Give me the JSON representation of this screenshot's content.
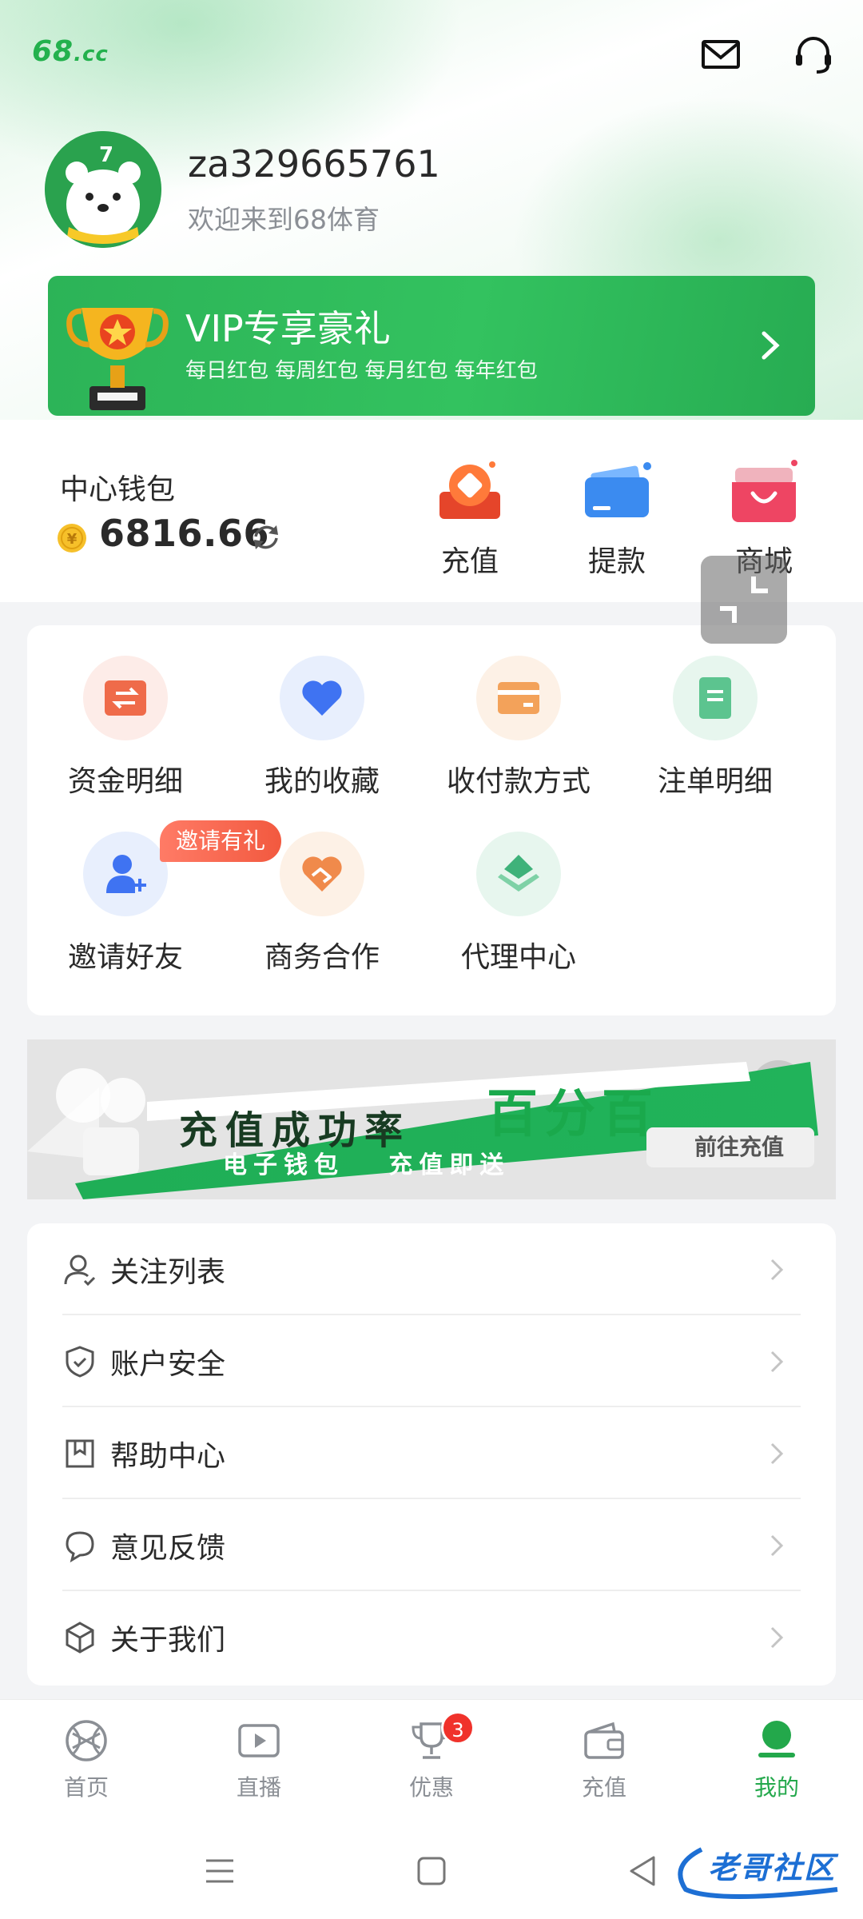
{
  "header": {
    "logo": "68",
    "logo_suffix": ".cc",
    "username": "za329665761",
    "welcome": "欢迎来到68体育"
  },
  "vip": {
    "title": "VIP专享豪礼",
    "subtitle": "每日红包 每周红包 每月红包 每年红包"
  },
  "wallet": {
    "label": "中心钱包",
    "balance": "6816.66",
    "actions": [
      {
        "label": "充值",
        "icon": "recharge-icon"
      },
      {
        "label": "提款",
        "icon": "withdraw-icon"
      },
      {
        "label": "商城",
        "icon": "mall-icon"
      }
    ]
  },
  "grid": {
    "items": [
      {
        "label": "资金明细",
        "icon": "fund-details-icon"
      },
      {
        "label": "我的收藏",
        "icon": "heart-icon"
      },
      {
        "label": "收付款方式",
        "icon": "card-icon"
      },
      {
        "label": "注单明细",
        "icon": "document-icon"
      },
      {
        "label": "邀请好友",
        "icon": "invite-user-icon"
      },
      {
        "label": "商务合作",
        "icon": "handshake-icon"
      },
      {
        "label": "代理中心",
        "icon": "layers-icon"
      }
    ],
    "invite_badge": "邀请有礼"
  },
  "promo": {
    "headline": "充值成功率",
    "highlight": "百分百",
    "subline": "电子钱包   充值即送",
    "cta": "前往充值"
  },
  "menu": [
    {
      "label": "关注列表",
      "icon": "user-follow-icon"
    },
    {
      "label": "账户安全",
      "icon": "shield-icon"
    },
    {
      "label": "帮助中心",
      "icon": "bookmark-icon"
    },
    {
      "label": "意见反馈",
      "icon": "chat-bubble-icon"
    },
    {
      "label": "关于我们",
      "icon": "cube-icon"
    }
  ],
  "nav": [
    {
      "label": "首页",
      "icon": "basketball-icon"
    },
    {
      "label": "直播",
      "icon": "play-icon"
    },
    {
      "label": "优惠",
      "icon": "trophy-icon",
      "badge": "3"
    },
    {
      "label": "充值",
      "icon": "wallet-icon"
    },
    {
      "label": "我的",
      "icon": "profile-icon",
      "active": true
    }
  ],
  "watermark": "老哥社区",
  "colors": {
    "brand_green": "#23b14d",
    "badge_red": "#f0322b",
    "text_dark": "#2a2a2a",
    "text_gray": "#8b8f95"
  }
}
